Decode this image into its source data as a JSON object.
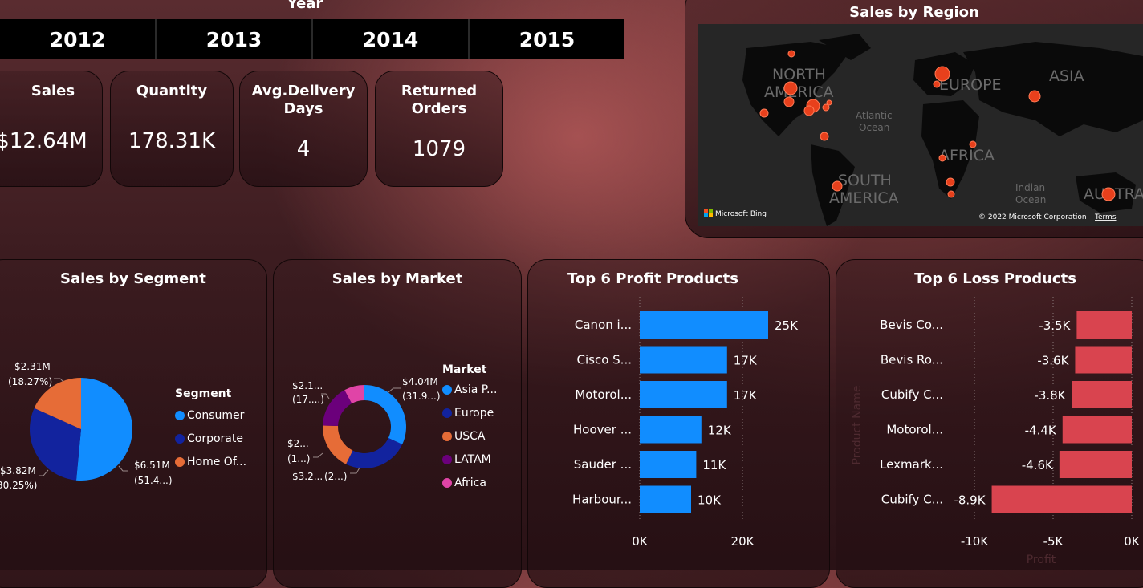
{
  "year_slicer": {
    "title": "Year",
    "years": [
      "2012",
      "2013",
      "2014",
      "2015"
    ]
  },
  "kpis": {
    "sales": {
      "label": "Sales",
      "value": "$12.64M"
    },
    "quantity": {
      "label": "Quantity",
      "value": "178.31K"
    },
    "delivery": {
      "label_line1": "Avg.Delivery",
      "label_line2": "Days",
      "value": "4"
    },
    "returned": {
      "label_line1": "Returned",
      "label_line2": "Orders",
      "value": "1079"
    }
  },
  "map": {
    "title": "Sales by Region",
    "labels": {
      "north_america_1": "NORTH",
      "north_america_2": "AMERICA",
      "europe": "EUROPE",
      "asia": "ASIA",
      "atlantic_1": "Atlantic",
      "atlantic_2": "Ocean",
      "africa": "AFRICA",
      "south_america_1": "SOUTH",
      "south_america_2": "AMERICA",
      "indian_1": "Indian",
      "indian_2": "Ocean",
      "australia": "AUSTRA"
    },
    "brand": "Microsoft Bing",
    "copyright": "© 2022 Microsoft Corporation",
    "terms": "Terms"
  },
  "segment_chart": {
    "title": "Sales by Segment",
    "legend_title": "Segment",
    "legend": [
      {
        "name": "Consumer",
        "color": "#118dff"
      },
      {
        "name": "Corporate",
        "color": "#12239e"
      },
      {
        "name": "Home Of...",
        "color": "#e66c37"
      }
    ],
    "labels": {
      "home_value": "$2.31M",
      "home_pct": "(18.27%)",
      "corporate_value": "$3.82M",
      "corporate_pct": "30.25%)",
      "consumer_value": "$6.51M",
      "consumer_pct": "(51.4...)"
    }
  },
  "market_chart": {
    "title": "Sales by Market",
    "legend_title": "Market",
    "legend": [
      {
        "name": "Asia P...",
        "color": "#118dff"
      },
      {
        "name": "Europe",
        "color": "#12239e"
      },
      {
        "name": "USCA",
        "color": "#e66c37"
      },
      {
        "name": "LATAM",
        "color": "#6b007b"
      },
      {
        "name": "Africa",
        "color": "#e044a7"
      }
    ],
    "labels": {
      "asia_value": "$4.04M",
      "asia_pct": "(31.9...)",
      "latam_value": "$2.1...",
      "latam_pct": "(17....)",
      "usca_value": "$2...",
      "usca_pct": "(1...)",
      "europe_value": "$3.2...",
      "europe_pct": "(2...)"
    }
  },
  "chart_data": [
    {
      "type": "pie",
      "title": "Sales by Segment",
      "categories": [
        "Consumer",
        "Corporate",
        "Home Office"
      ],
      "values": [
        6.51,
        3.82,
        2.31
      ],
      "percentages": [
        51.48,
        30.25,
        18.27
      ],
      "unit": "$M",
      "colors": [
        "#118dff",
        "#12239e",
        "#e66c37"
      ]
    },
    {
      "type": "pie",
      "title": "Sales by Market",
      "categories": [
        "Asia Pacific",
        "Europe",
        "USCA",
        "LATAM",
        "Africa"
      ],
      "values": [
        4.04,
        3.2,
        2.3,
        2.1,
        1.0
      ],
      "unit": "$M",
      "colors": [
        "#118dff",
        "#12239e",
        "#e66c37",
        "#6b007b",
        "#e044a7"
      ]
    },
    {
      "type": "bar",
      "orientation": "horizontal",
      "title": "Top 6 Profit Products",
      "categories": [
        "Canon i...",
        "Cisco S...",
        "Motorol...",
        "Hoover ...",
        "Sauder ...",
        "Harbour..."
      ],
      "values": [
        25000,
        17000,
        17000,
        12000,
        11000,
        10000
      ],
      "value_labels": [
        "25K",
        "17K",
        "17K",
        "12K",
        "11K",
        "10K"
      ],
      "xlim": [
        0,
        25000
      ],
      "x_ticks": [
        "0K",
        "20K"
      ],
      "color": "#118dff"
    },
    {
      "type": "bar",
      "orientation": "horizontal",
      "title": "Top 6 Loss Products",
      "categories": [
        "Bevis Co...",
        "Bevis Ro...",
        "Cubify C...",
        "Motorol...",
        "Lexmark...",
        "Cubify C..."
      ],
      "values": [
        -3500,
        -3600,
        -3800,
        -4400,
        -4600,
        -8900
      ],
      "value_labels": [
        "-3.5K",
        "-3.6K",
        "-3.8K",
        "-4.4K",
        "-4.6K",
        "-8.9K"
      ],
      "xlim": [
        -10000,
        0
      ],
      "x_ticks": [
        "-10K",
        "-5K",
        "0K"
      ],
      "ylabel": "Product Name",
      "xlabel": "Profit",
      "color": "#d9444f"
    }
  ]
}
